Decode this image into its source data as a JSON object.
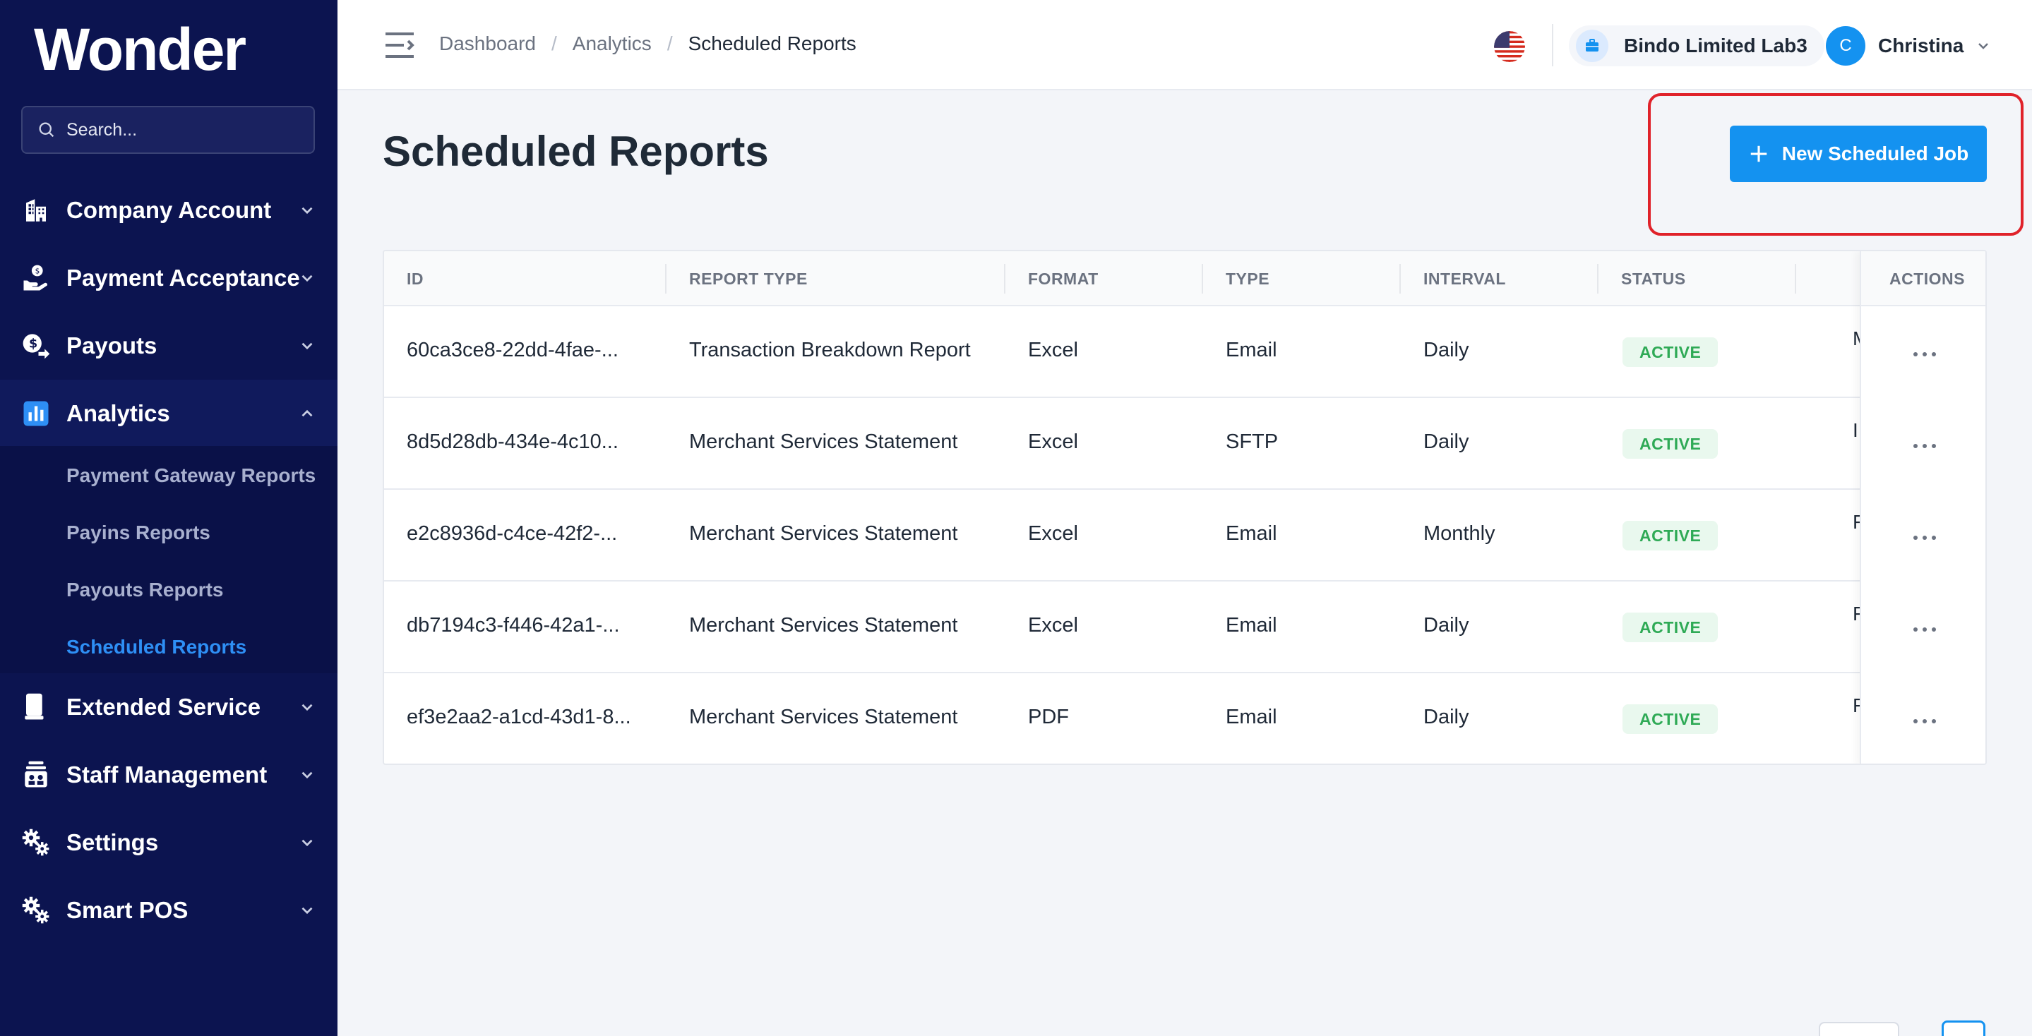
{
  "sidebar": {
    "logo": "Wonder",
    "search_placeholder": "Search...",
    "items": [
      {
        "label": "Company Account",
        "icon": "building-icon"
      },
      {
        "label": "Payment Acceptance",
        "icon": "hand-coin-icon"
      },
      {
        "label": "Payouts",
        "icon": "dollar-send-icon"
      },
      {
        "label": "Analytics",
        "icon": "bar-chart-icon",
        "expanded": true
      },
      {
        "label": "Extended Service",
        "icon": "tablet-icon"
      },
      {
        "label": "Staff Management",
        "icon": "staff-icon"
      },
      {
        "label": "Settings",
        "icon": "gears-icon"
      },
      {
        "label": "Smart POS",
        "icon": "gears-icon"
      }
    ],
    "analytics_sub": [
      {
        "label": "Payment Gateway Reports"
      },
      {
        "label": "Payins Reports"
      },
      {
        "label": "Payouts Reports"
      },
      {
        "label": "Scheduled Reports",
        "current": true
      }
    ]
  },
  "header": {
    "breadcrumb": [
      "Dashboard",
      "Analytics",
      "Scheduled Reports"
    ],
    "company": "Bindo Limited Lab3",
    "user_initial": "C",
    "user_name": "Christina"
  },
  "main": {
    "title": "Scheduled Reports",
    "new_button": "New Scheduled Job",
    "columns": [
      "ID",
      "REPORT TYPE",
      "FORMAT",
      "TYPE",
      "INTERVAL",
      "STATUS",
      "ACTIONS"
    ],
    "rows": [
      {
        "id": "60ca3ce8-22dd-4fae-...",
        "report_type": "Transaction Breakdown Report",
        "format": "Excel",
        "type": "Email",
        "interval": "Daily",
        "status": "ACTIVE",
        "clipped": "M"
      },
      {
        "id": "8d5d28db-434e-4c10...",
        "report_type": "Merchant Services Statement",
        "format": "Excel",
        "type": "SFTP",
        "interval": "Daily",
        "status": "ACTIVE",
        "clipped": "I"
      },
      {
        "id": "e2c8936d-c4ce-42f2-...",
        "report_type": "Merchant Services Statement",
        "format": "Excel",
        "type": "Email",
        "interval": "Monthly",
        "status": "ACTIVE",
        "clipped": "F"
      },
      {
        "id": "db7194c3-f446-42a1-...",
        "report_type": "Merchant Services Statement",
        "format": "Excel",
        "type": "Email",
        "interval": "Daily",
        "status": "ACTIVE",
        "clipped": "F"
      },
      {
        "id": "ef3e2aa2-a1cd-43d1-8...",
        "report_type": "Merchant Services Statement",
        "format": "PDF",
        "type": "Email",
        "interval": "Daily",
        "status": "ACTIVE",
        "clipped": "F"
      }
    ]
  },
  "colors": {
    "sidebar_bg": "#0c1450",
    "accent": "#1492f0",
    "status_active": "#2faa56",
    "highlight": "#e0222a"
  }
}
